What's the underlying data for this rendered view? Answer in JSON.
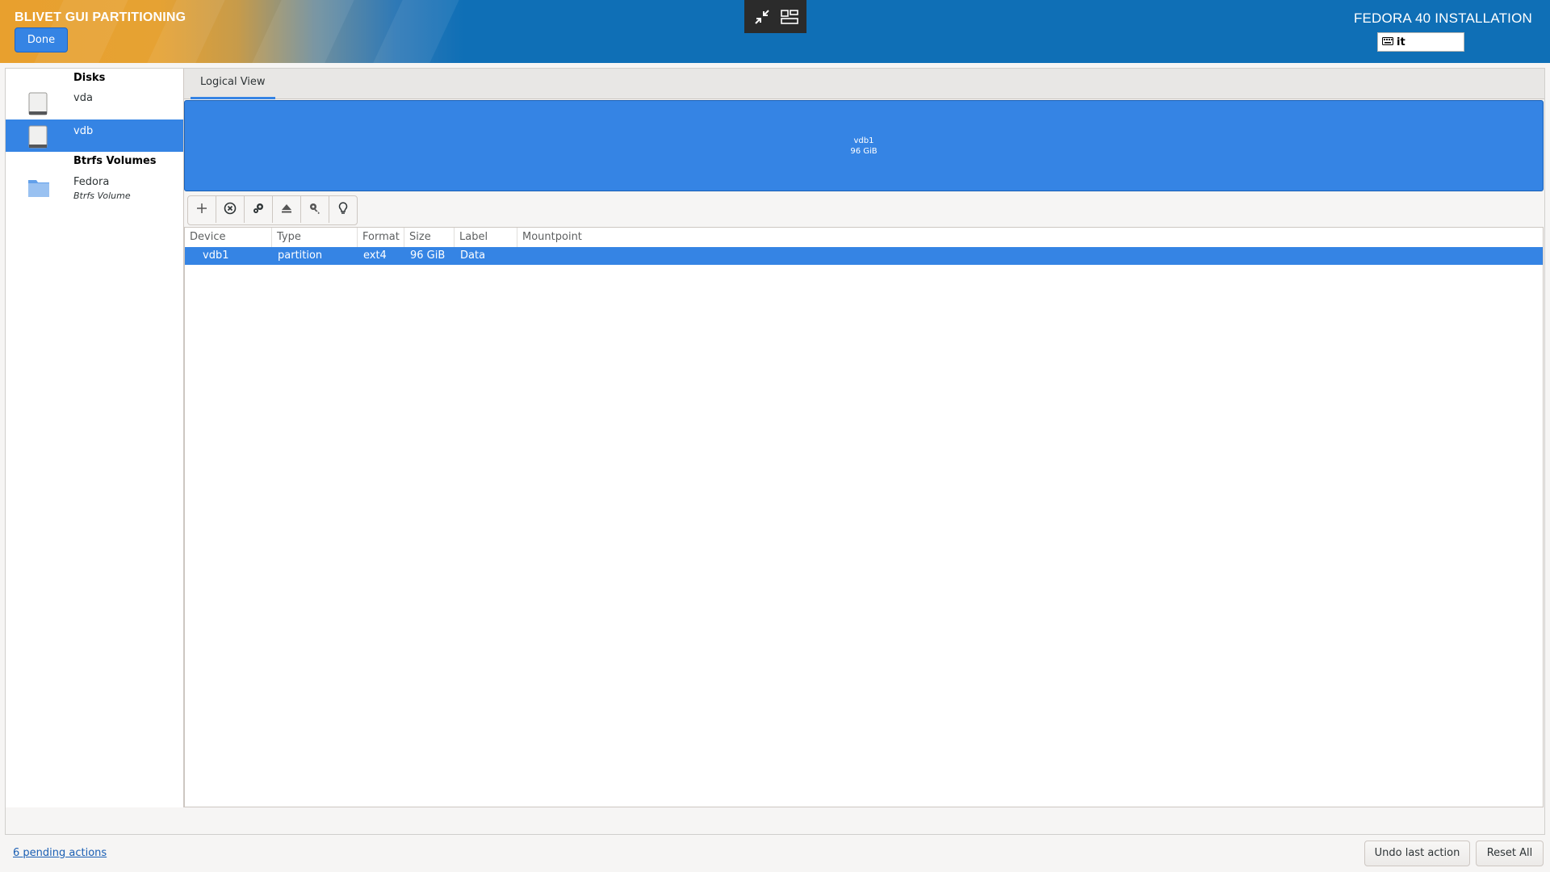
{
  "header": {
    "left_title": "BLIVET GUI PARTITIONING",
    "right_title": "FEDORA 40 INSTALLATION",
    "done_label": "Done",
    "keyboard_layout": "it",
    "accent_color": "#0f6fb6"
  },
  "view_tools": {
    "icons": [
      "unfullscreen-icon",
      "window-layout-icon"
    ]
  },
  "sidebar": {
    "disks_header": "Disks",
    "disks": [
      {
        "label": "vda",
        "icon": "drive-icon",
        "selected": false
      },
      {
        "label": "vdb",
        "icon": "drive-icon",
        "selected": true
      }
    ],
    "btrfs_header": "Btrfs Volumes",
    "btrfs": [
      {
        "label": "Fedora",
        "sublabel": "Btrfs Volume",
        "icon": "folder-icon"
      }
    ],
    "selection_color": "#3584e4"
  },
  "tabs": [
    {
      "label": "Logical View",
      "active": true
    }
  ],
  "device_block": {
    "name": "vdb1",
    "size": "96 GiB",
    "color": "#3584e4"
  },
  "toolbar": {
    "actions": [
      "add-icon",
      "delete-icon",
      "edit-icon",
      "unmount-icon",
      "decrypt-icon",
      "info-icon"
    ]
  },
  "table": {
    "columns": [
      "Device",
      "Type",
      "Format",
      "Size",
      "Label",
      "Mountpoint"
    ],
    "rows": [
      {
        "device": "vdb1",
        "type": "partition",
        "format": "ext4",
        "size": "96 GiB",
        "label": "Data",
        "mountpoint": "",
        "selected": true
      }
    ]
  },
  "footer": {
    "pending_actions": "6 pending actions",
    "undo_label": "Undo last action",
    "reset_label": "Reset All"
  }
}
